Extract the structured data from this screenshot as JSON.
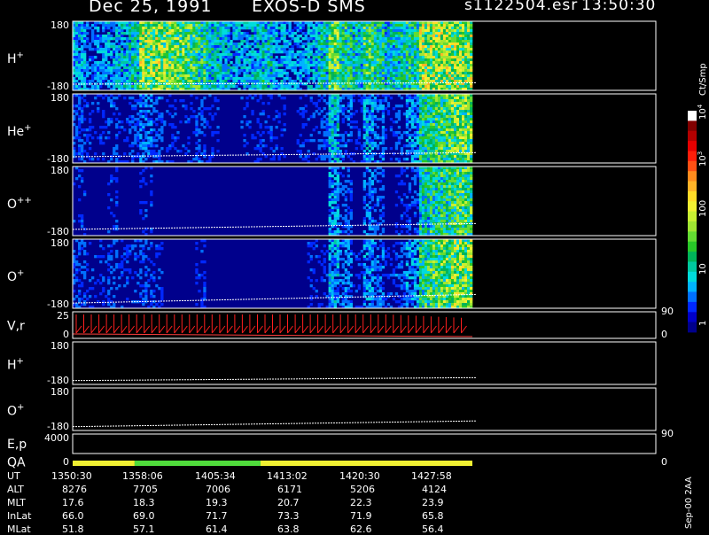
{
  "header": {
    "date": "Dec 25, 1991",
    "instrument": "EXOS-D SMS",
    "file": "s1122504.esr",
    "time": "13:50:30"
  },
  "colorbar": {
    "unit": "Ct/Smp",
    "tick_labels": [
      "1",
      "10",
      "100",
      "10",
      "10"
    ],
    "tick_exponents": [
      "",
      "",
      "",
      "3",
      "4"
    ],
    "colors": [
      "#00008c",
      "#0000c8",
      "#0028ff",
      "#0070ff",
      "#00b4ff",
      "#00dcdc",
      "#00c8a0",
      "#00b45a",
      "#28c828",
      "#64dc32",
      "#a0e632",
      "#c8f032",
      "#f0f032",
      "#ffdc28",
      "#ffb428",
      "#ff8c1e",
      "#ff5014",
      "#ff1e0a",
      "#e60000",
      "#b40000",
      "#820000",
      "#ffffff"
    ]
  },
  "footer": {
    "side_text": "Sep-00 2AA",
    "row_labels": [
      "UT",
      "ALT",
      "MLT",
      "InLat",
      "MLat"
    ],
    "columns": [
      [
        "1350:30",
        "8276",
        "17.6",
        "66.0",
        "51.8"
      ],
      [
        "1358:06",
        "7705",
        "18.3",
        "69.0",
        "57.1"
      ],
      [
        "1405:34",
        "7006",
        "19.3",
        "71.7",
        "61.4"
      ],
      [
        "1413:02",
        "6171",
        "20.7",
        "73.3",
        "63.8"
      ],
      [
        "1420:30",
        "5206",
        "22.3",
        "71.9",
        "62.6"
      ],
      [
        "1427:58",
        "4124",
        "23.9",
        "65.8",
        "56.4"
      ]
    ]
  },
  "chart_data": {
    "type": "heatmap",
    "time_range": [
      "1350:30",
      "1431:00"
    ],
    "panels": [
      {
        "label": "H",
        "superscript": "+",
        "ylim": [
          -180,
          180
        ],
        "tick_top": "180",
        "tick_bottom": "-180",
        "kind": "spectrogram",
        "activity": [
          0.5,
          0.4,
          0.45,
          0.5,
          0.55,
          0.6,
          0.95,
          0.95,
          0.9,
          0.85,
          0.8,
          0.75,
          0.6,
          0.55,
          0.5,
          0.5,
          0.55,
          0.6,
          0.5,
          0.45,
          0.45,
          0.5,
          0.6,
          0.85,
          0.7,
          0.6,
          0.8,
          0.7,
          0.6,
          0.65,
          0.7,
          0.95,
          0.95,
          0.95,
          0.95,
          0.95
        ],
        "trace": [
          -0.82,
          -0.78
        ]
      },
      {
        "label": "He",
        "superscript": "+",
        "ylim": [
          -180,
          180
        ],
        "tick_top": "180",
        "tick_bottom": "-180",
        "kind": "spectrogram",
        "activity": [
          0.35,
          0.3,
          0.3,
          0.35,
          0.3,
          0.35,
          0.4,
          0.35,
          0.3,
          0.3,
          0.3,
          0.35,
          0.3,
          0.25,
          0.25,
          0.3,
          0.3,
          0.3,
          0.3,
          0.25,
          0.3,
          0.3,
          0.35,
          0.55,
          0.4,
          0.3,
          0.5,
          0.4,
          0.3,
          0.35,
          0.45,
          0.7,
          0.75,
          0.8,
          0.85,
          0.85
        ],
        "trace": [
          -0.82,
          -0.7
        ]
      },
      {
        "label": "O",
        "superscript": "++",
        "ylim": [
          -180,
          180
        ],
        "tick_top": "180",
        "tick_bottom": "-180",
        "kind": "spectrogram",
        "activity": [
          0.3,
          0.25,
          0.25,
          0.3,
          0.25,
          0.25,
          0.3,
          0.25,
          0.2,
          0.2,
          0.2,
          0.25,
          0.2,
          0.2,
          0.2,
          0.2,
          0.2,
          0.2,
          0.2,
          0.2,
          0.2,
          0.25,
          0.25,
          0.45,
          0.35,
          0.25,
          0.4,
          0.35,
          0.25,
          0.3,
          0.35,
          0.65,
          0.7,
          0.75,
          0.8,
          0.8
        ],
        "trace": [
          -0.82,
          -0.65
        ]
      },
      {
        "label": "O",
        "superscript": "+",
        "ylim": [
          -180,
          180
        ],
        "tick_top": "180",
        "tick_bottom": "-180",
        "kind": "spectrogram",
        "activity": [
          0.35,
          0.3,
          0.3,
          0.35,
          0.3,
          0.3,
          0.35,
          0.3,
          0.25,
          0.25,
          0.25,
          0.3,
          0.25,
          0.2,
          0.2,
          0.25,
          0.25,
          0.25,
          0.25,
          0.2,
          0.25,
          0.3,
          0.3,
          0.5,
          0.4,
          0.3,
          0.45,
          0.4,
          0.3,
          0.35,
          0.45,
          0.75,
          0.8,
          0.85,
          0.9,
          0.9
        ],
        "trace": [
          -0.85,
          -0.6
        ]
      },
      {
        "label": "V,r",
        "superscript": "",
        "ylim": [
          0,
          25
        ],
        "tick_top": "25",
        "tick_bottom": "0",
        "right_top": "90",
        "right_bottom": "0",
        "kind": "velocity",
        "spikes": 52
      },
      {
        "label": "H",
        "superscript": "+",
        "ylim": [
          -180,
          180
        ],
        "tick_top": "180",
        "tick_bottom": "-180",
        "kind": "trace",
        "trace": [
          -0.82,
          -0.68
        ]
      },
      {
        "label": "O",
        "superscript": "+",
        "ylim": [
          -180,
          180
        ],
        "tick_top": "180",
        "tick_bottom": "-180",
        "kind": "trace",
        "trace": [
          -0.82,
          -0.55
        ]
      },
      {
        "label": "E,p",
        "superscript": "",
        "tick_top": "4000",
        "tick_bottom": "",
        "right_top": "90",
        "right_bottom": "",
        "kind": "empty"
      },
      {
        "label": "QA",
        "superscript": "",
        "tick_top": "",
        "tick_bottom": "0",
        "right_top": "",
        "right_bottom": "0",
        "kind": "quality",
        "segments": [
          {
            "color": "#f0f032",
            "span": [
              0.0,
              0.155
            ]
          },
          {
            "color": "#50dc3c",
            "span": [
              0.155,
              0.47
            ]
          },
          {
            "color": "#f0f032",
            "span": [
              0.47,
              1.0
            ]
          }
        ]
      }
    ]
  }
}
